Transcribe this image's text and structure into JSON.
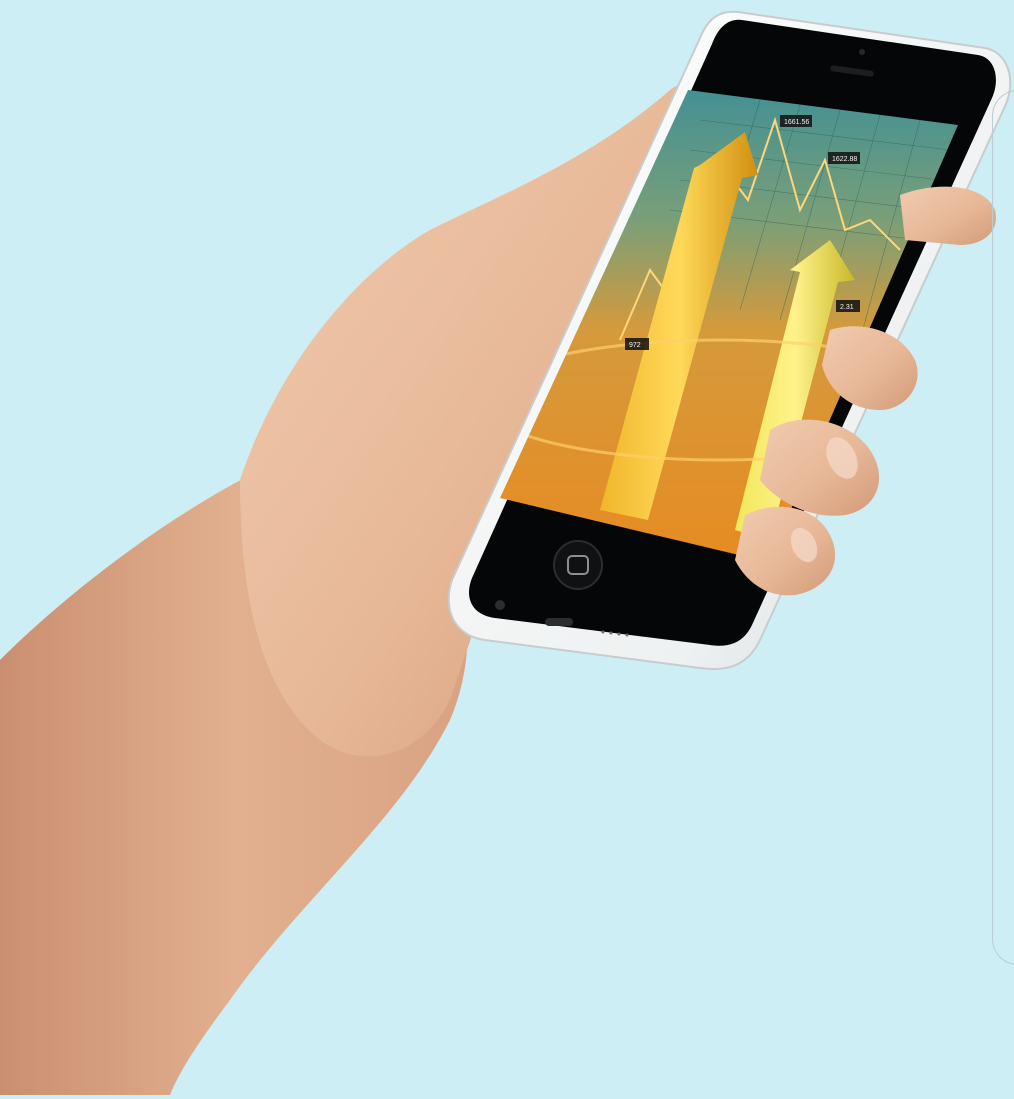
{
  "scene": {
    "background_color": "#cdeef4",
    "device_body_color": "#f4f6f6",
    "screen_bezel_color": "#050607",
    "skin_color": "#e7b897"
  },
  "screen": {
    "labels": [
      "1661.56",
      "1622.88",
      "972",
      "2.31"
    ]
  }
}
